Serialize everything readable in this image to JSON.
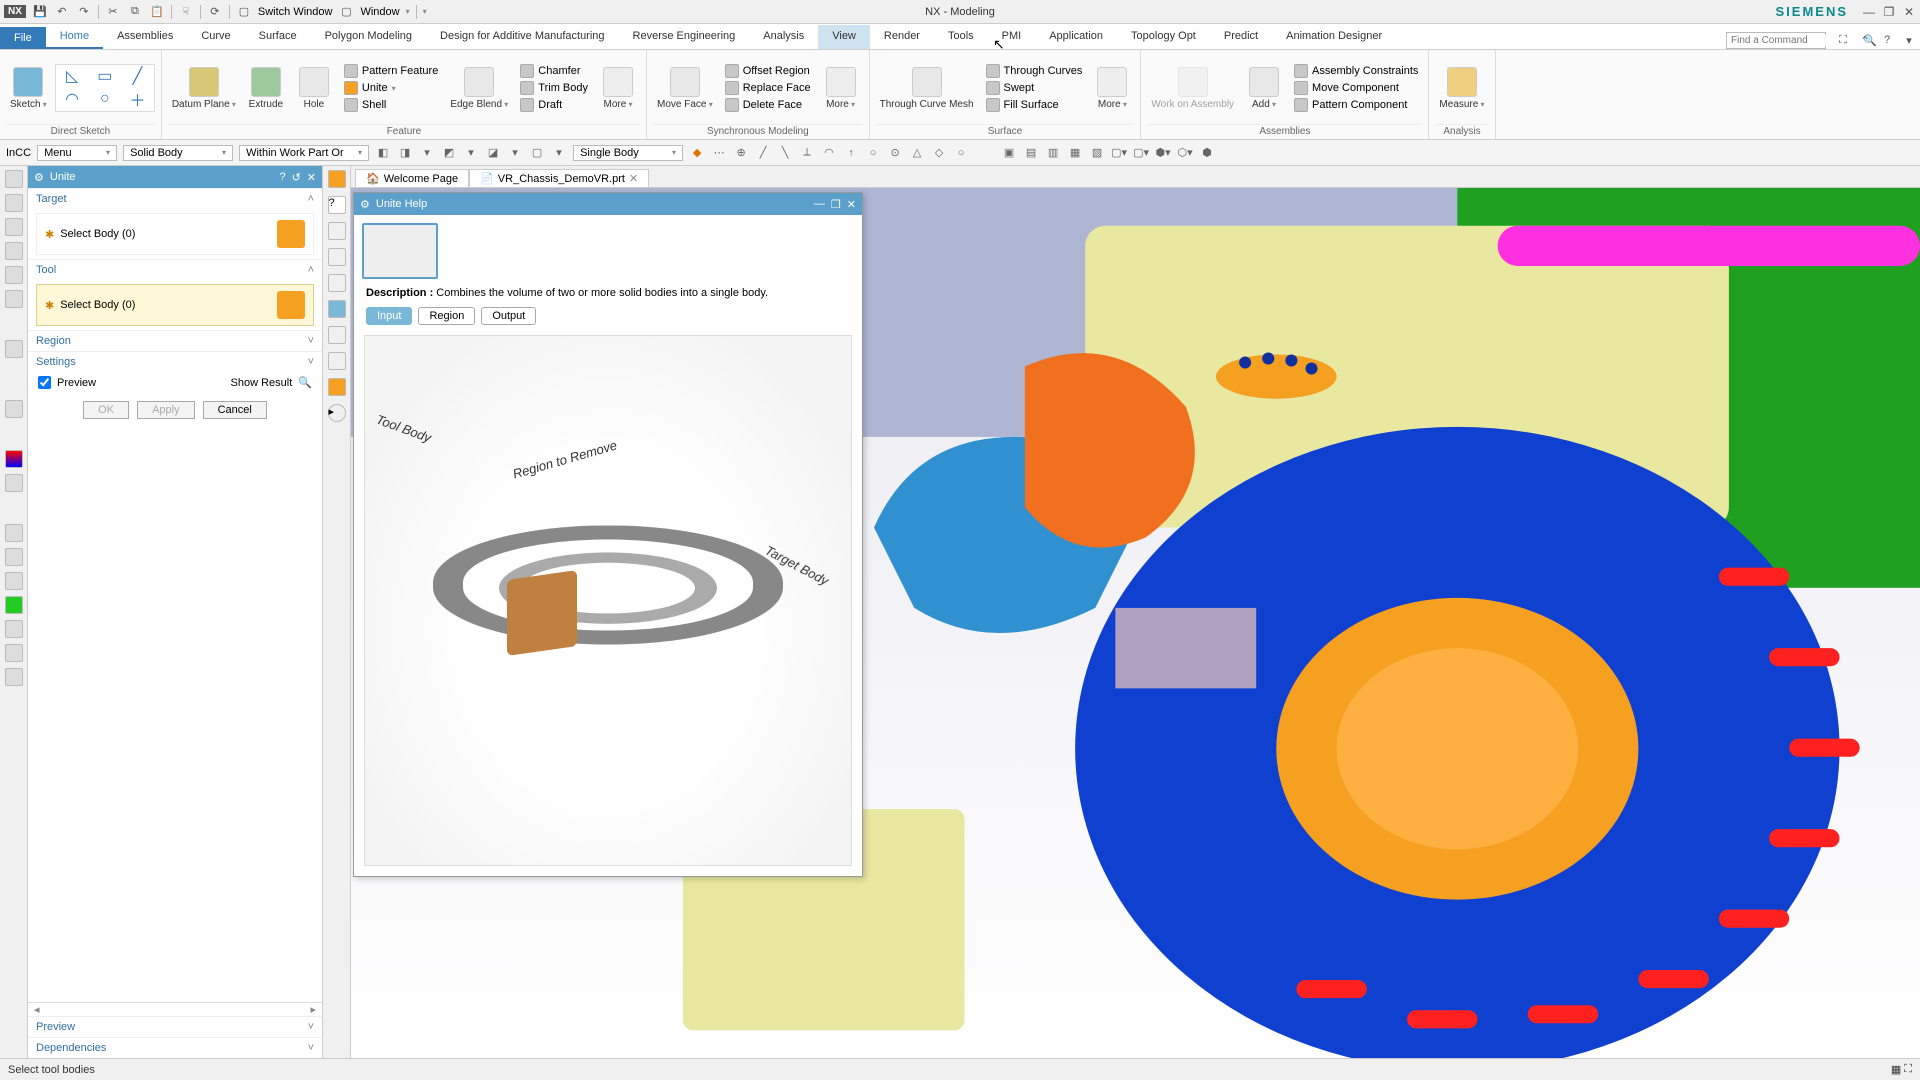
{
  "app": {
    "title": "NX - Modeling",
    "brand": "SIEMENS"
  },
  "qat": {
    "switch_window": "Switch Window",
    "window": "Window"
  },
  "tabs": {
    "file": "File",
    "items": [
      "Home",
      "Assemblies",
      "Curve",
      "Surface",
      "Polygon Modeling",
      "Design for Additive Manufacturing",
      "Reverse Engineering",
      "Analysis",
      "View",
      "Render",
      "Tools",
      "PMI",
      "Application",
      "Topology Opt",
      "Predict",
      "Animation Designer"
    ],
    "active": 0,
    "find_placeholder": "Find a Command"
  },
  "ribbon": {
    "direct_sketch": {
      "sketch": "Sketch",
      "group": "Direct Sketch"
    },
    "feature": {
      "datum": "Datum\nPlane",
      "extrude": "Extrude",
      "hole": "Hole",
      "pattern": "Pattern Feature",
      "unite": "Unite",
      "shell": "Shell",
      "edge_blend": "Edge\nBlend",
      "chamfer": "Chamfer",
      "trim": "Trim Body",
      "draft": "Draft",
      "more": "More",
      "group": "Feature"
    },
    "sync": {
      "move_face": "Move\nFace",
      "offset": "Offset Region",
      "replace": "Replace Face",
      "delete": "Delete Face",
      "more": "More",
      "group": "Synchronous Modeling"
    },
    "surface": {
      "curve_mesh": "Through\nCurve Mesh",
      "through_curves": "Through Curves",
      "swept": "Swept",
      "fill": "Fill Surface",
      "more": "More",
      "group": "Surface"
    },
    "assemblies": {
      "work": "Work on\nAssembly",
      "add": "Add",
      "constraints": "Assembly Constraints",
      "move": "Move Component",
      "pattern": "Pattern Component",
      "group": "Assemblies"
    },
    "analysis": {
      "measure": "Measure",
      "group": "Analysis"
    }
  },
  "selbar": {
    "menu": "Menu",
    "type_filter": "Solid Body",
    "scope": "Within Work Part Or",
    "rule": "Single Body"
  },
  "doctabs": [
    {
      "label": "Welcome Page",
      "closable": false
    },
    {
      "label": "VR_Chassis_DemoVR.prt",
      "closable": true,
      "active": true
    }
  ],
  "panel": {
    "title": "Unite",
    "target": {
      "header": "Target",
      "select": "Select Body (0)"
    },
    "tool": {
      "header": "Tool",
      "select": "Select Body (0)"
    },
    "region": "Region",
    "settings": "Settings",
    "preview_chk": "Preview",
    "show_result": "Show Result",
    "ok": "OK",
    "apply": "Apply",
    "cancel": "Cancel",
    "preview_foot": "Preview",
    "dependencies": "Dependencies"
  },
  "help": {
    "title": "Unite Help",
    "desc_label": "Description :",
    "desc": "Combines the volume of two or more solid bodies into a single body.",
    "tabs": [
      "Input",
      "Region",
      "Output"
    ],
    "active_tab": 0,
    "labels": {
      "tool": "Tool Body",
      "region": "Region to Remove",
      "target": "Target Body"
    }
  },
  "status": {
    "msg": "Select tool bodies"
  }
}
